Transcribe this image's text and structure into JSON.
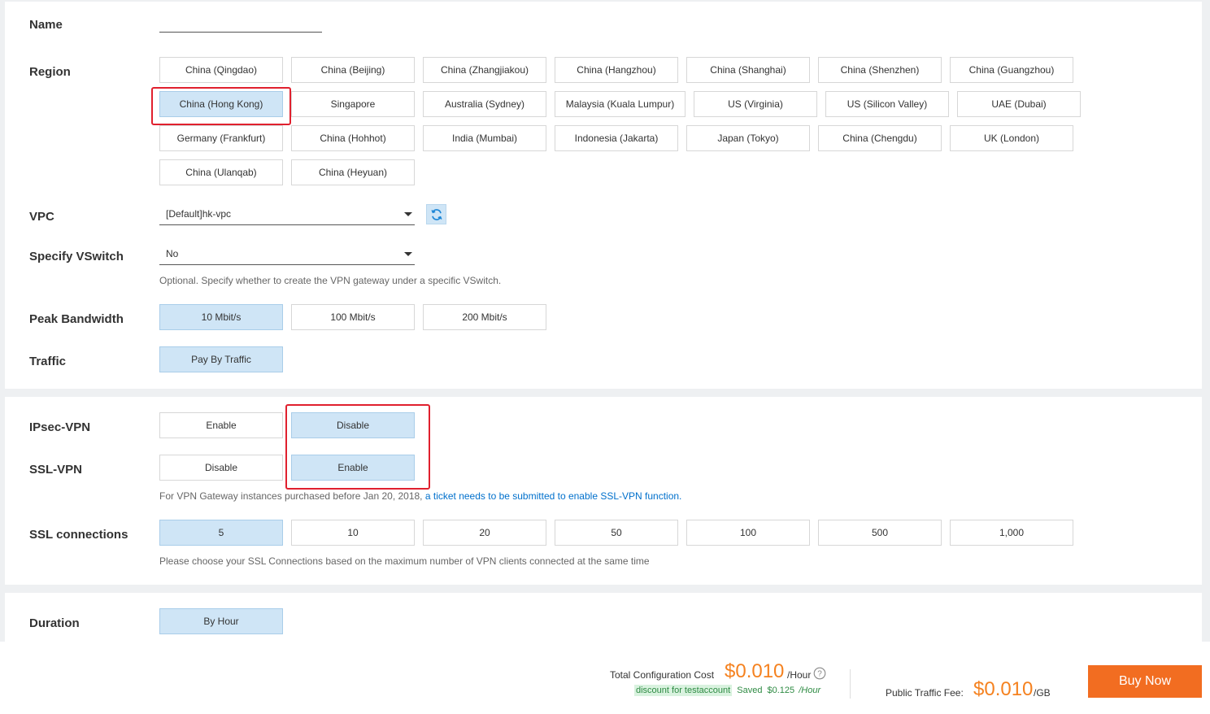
{
  "form": {
    "name": {
      "label": "Name",
      "value": ""
    },
    "region": {
      "label": "Region",
      "selected": "China (Hong Kong)",
      "options": [
        "China (Qingdao)",
        "China (Beijing)",
        "China (Zhangjiakou)",
        "China (Hangzhou)",
        "China (Shanghai)",
        "China (Shenzhen)",
        "China (Guangzhou)",
        "China (Hong Kong)",
        "Singapore",
        "Australia (Sydney)",
        "Malaysia (Kuala Lumpur)",
        "US (Virginia)",
        "US (Silicon Valley)",
        "UAE (Dubai)",
        "Germany (Frankfurt)",
        "China (Hohhot)",
        "India (Mumbai)",
        "Indonesia (Jakarta)",
        "Japan (Tokyo)",
        "China (Chengdu)",
        "UK (London)",
        "China (Ulanqab)",
        "China (Heyuan)"
      ]
    },
    "vpc": {
      "label": "VPC",
      "value": "[Default]hk-vpc"
    },
    "vswitch": {
      "label": "Specify VSwitch",
      "value": "No",
      "hint": "Optional. Specify whether to create the VPN gateway under a specific VSwitch."
    },
    "bandwidth": {
      "label": "Peak Bandwidth",
      "selected": "10 Mbit/s",
      "options": [
        "10 Mbit/s",
        "100 Mbit/s",
        "200 Mbit/s"
      ]
    },
    "traffic": {
      "label": "Traffic",
      "selected": "Pay By Traffic",
      "options": [
        "Pay By Traffic"
      ]
    },
    "ipsec": {
      "label": "IPsec-VPN",
      "selected": "Disable",
      "options": [
        "Enable",
        "Disable"
      ]
    },
    "ssl": {
      "label": "SSL-VPN",
      "selected": "Enable",
      "options": [
        "Disable",
        "Enable"
      ],
      "hint_prefix": "For VPN Gateway instances purchased before Jan 20, 2018, ",
      "hint_link": "a ticket needs to be submitted to enable SSL-VPN function."
    },
    "ssl_connections": {
      "label": "SSL connections",
      "selected": "5",
      "options": [
        "5",
        "10",
        "20",
        "50",
        "100",
        "500",
        "1,000"
      ],
      "hint": "Please choose your SSL Connections based on the maximum number of VPN clients connected at the same time"
    },
    "duration": {
      "label": "Duration",
      "selected": "By Hour",
      "options": [
        "By Hour"
      ]
    }
  },
  "footer": {
    "total_label": "Total Configuration Cost",
    "total_price": "$0.010",
    "total_unit": "/Hour",
    "discount_tag": "discount for testaccount",
    "saved_label": "Saved",
    "saved_amount": "$0.125",
    "saved_unit": "/Hour",
    "traffic_label": "Public Traffic Fee:",
    "traffic_price": "$0.010",
    "traffic_unit": "/GB",
    "buy_label": "Buy Now"
  },
  "colors": {
    "selected_bg": "#cfe5f6",
    "highlight": "#e0202e",
    "price": "#f58220",
    "buy_button": "#f26d21",
    "link": "#0070cc"
  }
}
